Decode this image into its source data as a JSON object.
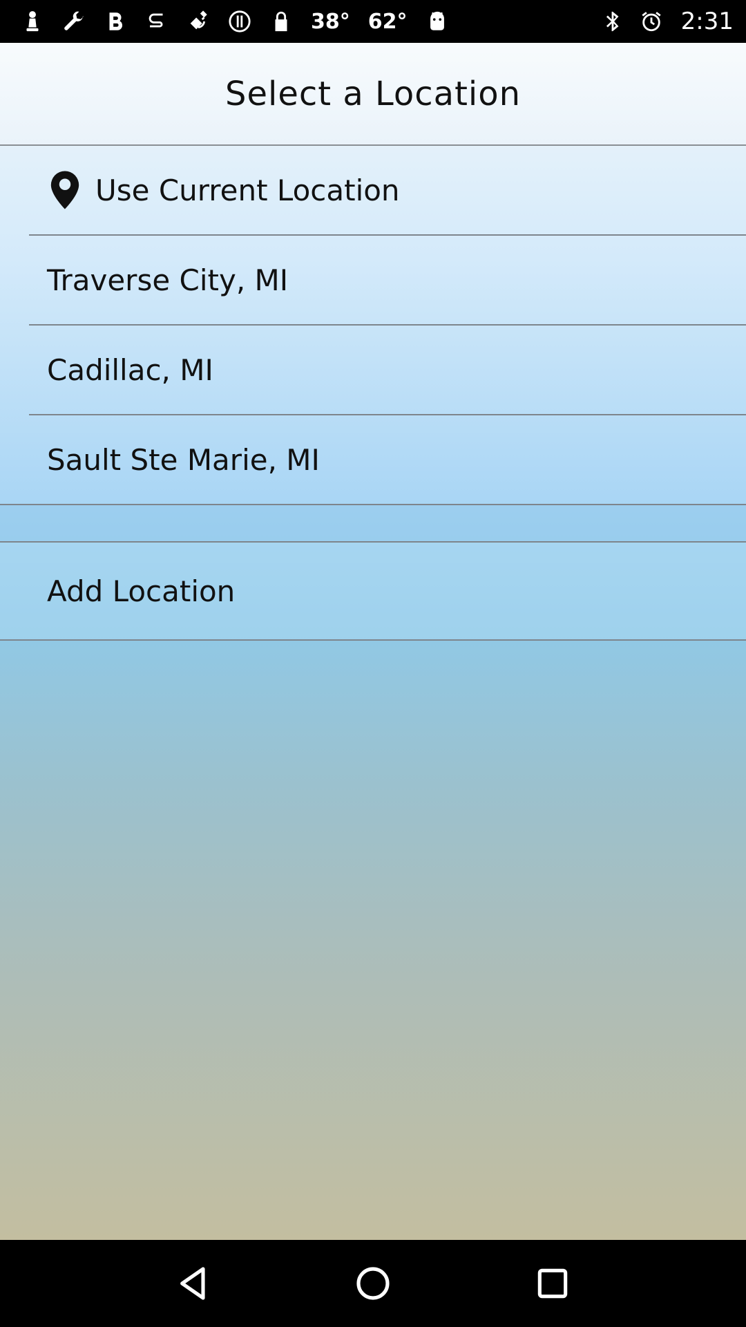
{
  "status_bar": {
    "icons": [
      "chess-pawn-icon",
      "wrench-icon",
      "bold-b-icon",
      "s-swirl-icon",
      "fake-gps-satellite-icon",
      "alert-circle-icon",
      "lock-icon"
    ],
    "temp_1": "38°",
    "temp_2": "62°",
    "right_icons": [
      "android-icon",
      "bluetooth-icon",
      "alarm-icon"
    ],
    "time": "2:31"
  },
  "header": {
    "title": "Select a Location"
  },
  "locations": {
    "current": {
      "icon": "location-pin-icon",
      "label": "Use Current Location"
    },
    "saved": [
      {
        "label": "Traverse City, MI"
      },
      {
        "label": "Cadillac, MI"
      },
      {
        "label": "Sault Ste Marie, MI"
      }
    ],
    "add_label": "Add Location"
  },
  "nav_bar": {
    "buttons": [
      "back-icon",
      "home-icon",
      "recents-icon"
    ]
  }
}
